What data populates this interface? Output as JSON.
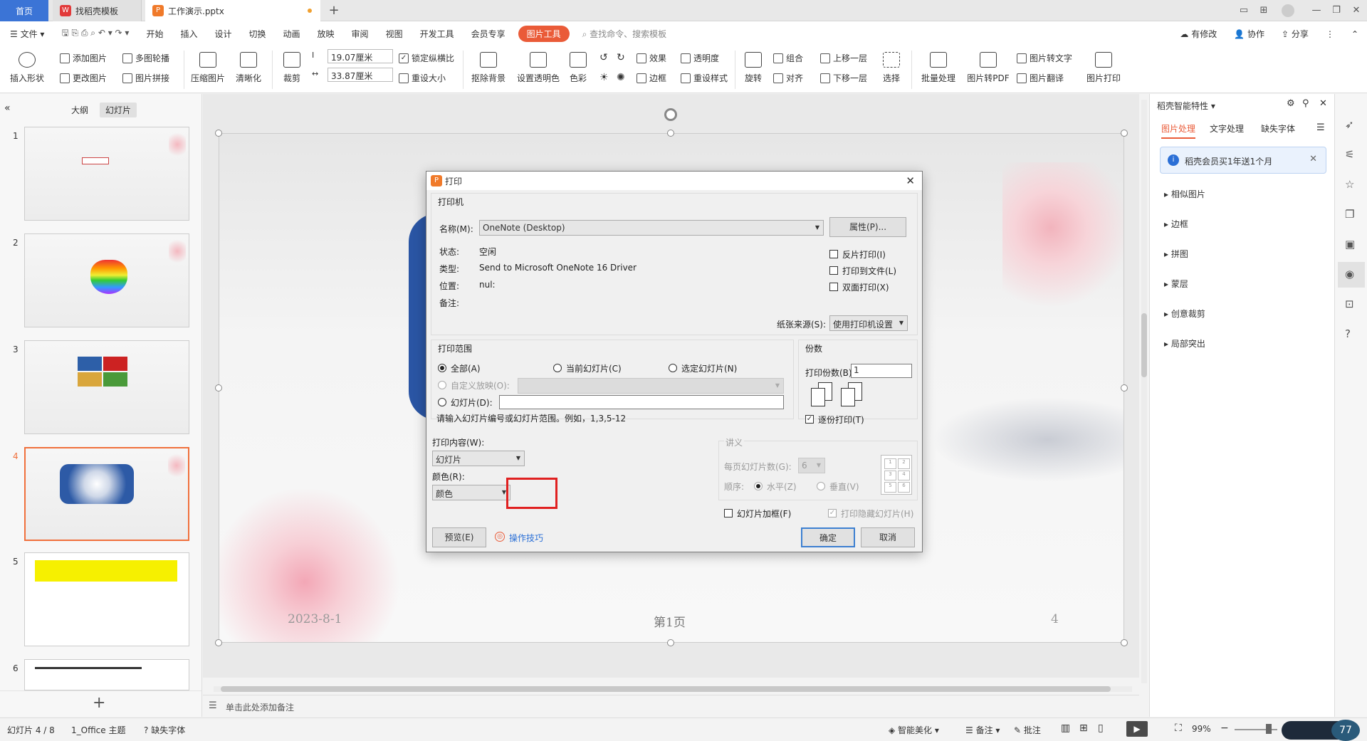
{
  "titlebar": {
    "tabs": [
      {
        "label": "首页"
      },
      {
        "label": "找稻壳模板"
      },
      {
        "label": "工作演示.pptx"
      }
    ],
    "new_tab": "+"
  },
  "menubar": {
    "file": "文件",
    "items": [
      "开始",
      "插入",
      "设计",
      "切换",
      "动画",
      "放映",
      "审阅",
      "视图",
      "开发工具",
      "会员专享"
    ],
    "active": "图片工具",
    "search": "查找命令、搜索模板",
    "right": [
      "有修改",
      "协作",
      "分享"
    ]
  },
  "ribbon": {
    "insert_shape": "插入形状",
    "add_picture": "添加图片",
    "change_picture": "更改图片",
    "multi_carousel": "多图轮播",
    "picture_collage": "图片拼接",
    "compress": "压缩图片",
    "clarify": "清晰化",
    "crop": "裁剪",
    "height": "19.07厘米",
    "width": "33.87厘米",
    "lock_ratio": "锁定纵横比",
    "reset_size": "重设大小",
    "remove_bg": "抠除背景",
    "set_transparent": "设置透明色",
    "color": "色彩",
    "effects": "效果",
    "border": "边框",
    "transparency": "透明度",
    "reset_style": "重设样式",
    "rotate": "旋转",
    "group": "组合",
    "align": "对齐",
    "bring_forward": "上移一层",
    "send_backward": "下移一层",
    "select": "选择",
    "batch": "批量处理",
    "to_pdf": "图片转PDF",
    "to_text": "图片转文字",
    "translate": "图片翻译",
    "print": "图片打印"
  },
  "left_panel": {
    "tab_outline": "大纲",
    "tab_slides": "幻灯片",
    "slide_numbers": [
      "1",
      "2",
      "3",
      "4",
      "5",
      "6"
    ],
    "add": "+"
  },
  "slide": {
    "date": "2023-8-1",
    "page": "第1页",
    "num": "4"
  },
  "notes": {
    "placeholder": "单击此处添加备注"
  },
  "statusbar": {
    "slide_count": "幻灯片 4 / 8",
    "theme": "1_Office 主题",
    "missing_font": "缺失字体",
    "smart_beautify": "智能美化",
    "notes": "备注",
    "comments": "批注",
    "zoom": "99%"
  },
  "right_panel": {
    "title": "稻壳智能特性",
    "tabs": [
      "图片处理",
      "文字处理",
      "缺失字体"
    ],
    "banner": "稻壳会员买1年送1个月",
    "items": [
      "相似图片",
      "边框",
      "拼图",
      "蒙层",
      "创意裁剪",
      "局部突出"
    ]
  },
  "dialog": {
    "title": "打印",
    "printer_group": "打印机",
    "name_label": "名称(M):",
    "printer_name": "OneNote (Desktop)",
    "properties_btn": "属性(P)...",
    "status_label": "状态:",
    "status_value": "空闲",
    "type_label": "类型:",
    "type_value": "Send to Microsoft OneNote 16 Driver",
    "where_label": "位置:",
    "where_value": "nul:",
    "comment_label": "备注:",
    "reverse_print": "反片打印(I)",
    "print_to_file": "打印到文件(L)",
    "duplex": "双面打印(X)",
    "paper_source_label": "纸张来源(S):",
    "paper_source_value": "使用打印机设置",
    "range_group": "打印范围",
    "all": "全部(A)",
    "current": "当前幻灯片(C)",
    "selection": "选定幻灯片(N)",
    "custom_show": "自定义放映(O):",
    "slides": "幻灯片(D):",
    "range_hint": "请输入幻灯片编号或幻灯片范围。例如，1,3,5-12",
    "copies_group": "份数",
    "copies_label": "打印份数(B):",
    "copies_value": "1",
    "collate": "逐份打印(T)",
    "content_label": "打印内容(W):",
    "content_value": "幻灯片",
    "color_label": "颜色(R):",
    "color_value": "颜色",
    "handout_group": "讲义",
    "per_page_label": "每页幻灯片数(G):",
    "per_page_value": "6",
    "order_label": "顺序:",
    "horizontal": "水平(Z)",
    "vertical": "垂直(V)",
    "frame_slides": "幻灯片加框(F)",
    "print_hidden": "打印隐藏幻灯片(H)",
    "preview_btn": "预览(E)",
    "tips": "操作技巧",
    "ok_btn": "确定",
    "cancel_btn": "取消",
    "handout_grid": [
      "1",
      "2",
      "3",
      "4",
      "5",
      "6"
    ]
  },
  "colors": {
    "accent": "#ea5b38",
    "home_tab": "#3b74d6",
    "highlight_box": "#e02020"
  }
}
